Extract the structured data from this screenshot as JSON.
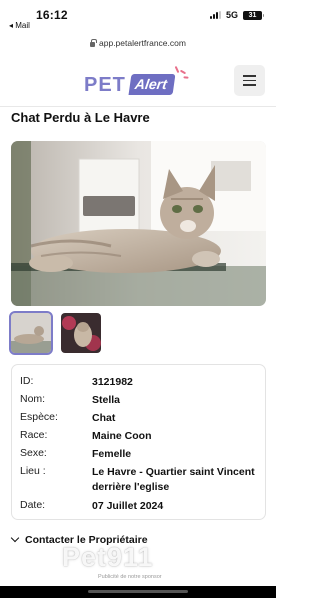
{
  "status_bar": {
    "time": "16:12",
    "back_app": "◂ Mail",
    "network": "5G",
    "battery": "31"
  },
  "browser": {
    "url": "app.petalertfrance.com"
  },
  "header": {
    "logo_pet": "PET",
    "logo_alert": "Alert",
    "menu_icon": "hamburger-icon"
  },
  "page": {
    "title": "Chat Perdu à Le Havre"
  },
  "gallery": {
    "main_alt": "cat lying on glass table",
    "thumbnails": [
      "cat photo 1",
      "cat photo 2"
    ]
  },
  "details": [
    {
      "label": "ID:",
      "value": "3121982"
    },
    {
      "label": "Nom:",
      "value": "Stella"
    },
    {
      "label": "Espèce:",
      "value": "Chat"
    },
    {
      "label": "Race:",
      "value": "Maine Coon"
    },
    {
      "label": "Sexe:",
      "value": "Femelle"
    },
    {
      "label": "Lieu :",
      "value": "Le Havre -  Quartier saint Vincent derrière l'eglise"
    },
    {
      "label": "Date:",
      "value": "07 Juillet 2024"
    }
  ],
  "contact": {
    "label": "Contacter le Propriétaire"
  },
  "watermark": {
    "brand": "Pet911",
    "note": "Publicité de notre sponsor"
  },
  "colors": {
    "brand": "#6e6ec2",
    "brand_light": "#7d7cc8",
    "accent": "#e8708b"
  }
}
